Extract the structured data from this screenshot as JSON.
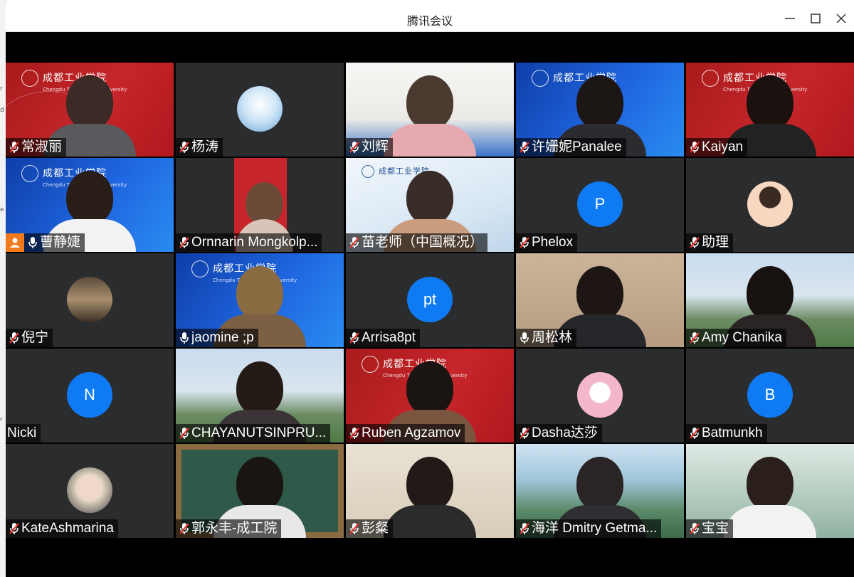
{
  "window": {
    "title": "腾讯会议"
  },
  "participants": [
    {
      "name": "常淑丽",
      "mic": "muted",
      "bg": "red"
    },
    {
      "name": "杨涛",
      "mic": "muted",
      "bg": "avatar-photo"
    },
    {
      "name": "刘辉",
      "mic": "muted",
      "bg": "room"
    },
    {
      "name": "许姗妮Panalee",
      "mic": "muted",
      "bg": "blue"
    },
    {
      "name": "Kaiyan",
      "mic": "muted",
      "bg": "red"
    },
    {
      "name": "曹静婕",
      "mic": "on",
      "host": true,
      "bg": "blue"
    },
    {
      "name": "Ornnarin Mongkolp...",
      "mic": "muted",
      "bg": "dark-red"
    },
    {
      "name": "苗老师（中国概况）",
      "mic": "muted",
      "bg": "light"
    },
    {
      "name": "Phelox",
      "mic": "muted",
      "bg": "avatar-letter",
      "initials": "P"
    },
    {
      "name": "助理",
      "mic": "muted",
      "bg": "avatar-photo"
    },
    {
      "name": "倪宁",
      "mic": "muted",
      "bg": "avatar-photo"
    },
    {
      "name": "jaomine ;p",
      "mic": "on",
      "bg": "blue"
    },
    {
      "name": "Arrisa8pt",
      "mic": "muted",
      "bg": "avatar-letter",
      "initials": "pt"
    },
    {
      "name": "周松林",
      "mic": "on",
      "bg": "beige"
    },
    {
      "name": "Amy Chanika",
      "mic": "muted",
      "bg": "city"
    },
    {
      "name": "Nicki",
      "mic": "none",
      "bg": "avatar-letter",
      "initials": "N"
    },
    {
      "name": "CHAYANUTSINPRU...",
      "mic": "muted",
      "bg": "city"
    },
    {
      "name": "Ruben Agzamov",
      "mic": "muted",
      "bg": "red"
    },
    {
      "name": "Dasha达莎",
      "mic": "muted",
      "bg": "avatar-photo"
    },
    {
      "name": "Batmunkh",
      "mic": "muted",
      "bg": "avatar-letter",
      "initials": "B"
    },
    {
      "name": "KateAshmarina",
      "mic": "muted",
      "bg": "avatar-photo"
    },
    {
      "name": "郭永丰-成工院",
      "mic": "muted",
      "bg": "board"
    },
    {
      "name": "彭粲",
      "mic": "muted",
      "bg": "shelf"
    },
    {
      "name": "海洋 Dmitry Getma...",
      "mic": "muted",
      "bg": "mountain"
    },
    {
      "name": "宝宝",
      "mic": "muted",
      "bg": "lake"
    }
  ],
  "colors": {
    "accent": "#0e7bf5",
    "mutedMic": "#e5322d",
    "host": "#f07a1d"
  }
}
